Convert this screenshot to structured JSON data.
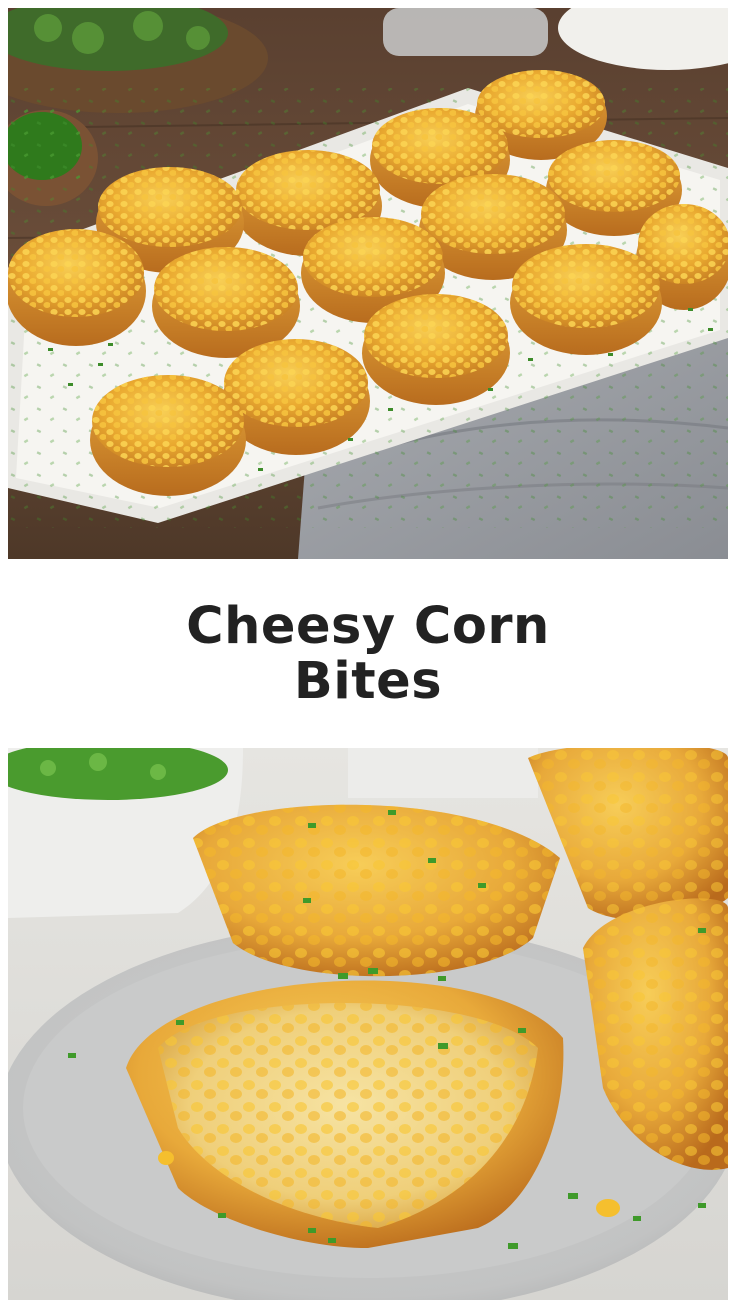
{
  "title": "Cheesy Corn Bites",
  "palette": {
    "background": "#ffffff",
    "title_text": "#222222",
    "corn_gold": "#f2b631",
    "crust_brown": "#c77a25",
    "chive_green": "#3d8c2a"
  },
  "images": {
    "top": "Platter of baked cheesy corn bites garnished with chives, on a wooden table with a gray linen napkin",
    "bottom": "Close-up of cheesy corn bites on a gray plate, one broken open showing a melty corn and cheese interior"
  }
}
